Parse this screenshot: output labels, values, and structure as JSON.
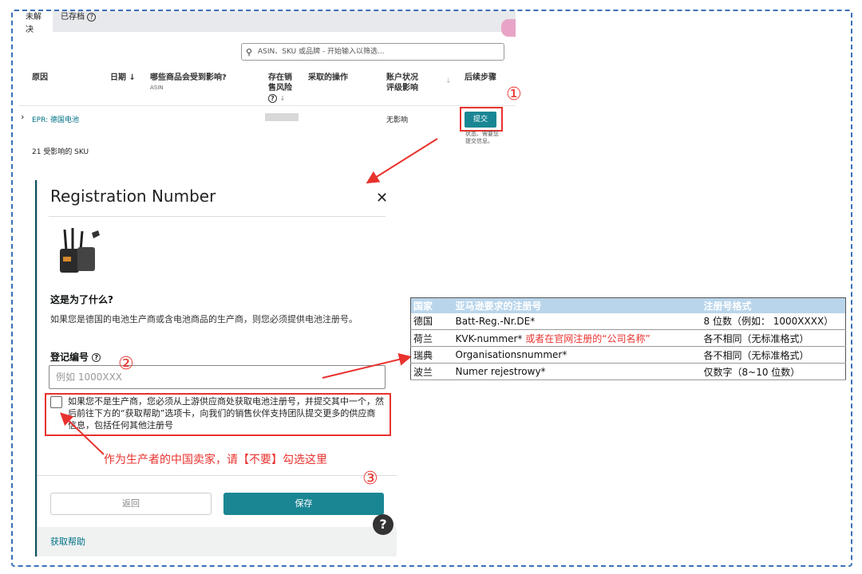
{
  "tabs": {
    "unresolved": "未解决",
    "archived": "已存档"
  },
  "search": {
    "placeholder": "ASIN、SKU 或品牌 - 开始输入以筛选..."
  },
  "columns": {
    "reason": "原因",
    "date": "日期 ↓",
    "affected": "哪些商品会受到影响?",
    "affected_sub": "ASIN",
    "risk_line1": "存在销",
    "risk_line2": "售风险",
    "action": "采取的操作",
    "health_line1": "账户状况",
    "health_line2": "评级影响",
    "next": "后续步骤"
  },
  "row": {
    "reason": "EPR: 德国电池",
    "health": "无影响",
    "submit": "提交",
    "status_note": "状态、需要您提交信息。",
    "sku_count": "21 受影响的 SKU"
  },
  "markers": {
    "one": "①",
    "two": "②",
    "three": "③"
  },
  "modal": {
    "title": "Registration Number",
    "why_heading": "这是为了什么?",
    "why_text": "如果您是德国的电池生产商或含电池商品的生产商，则您必须提供电池注册号。",
    "reg_label": "登记编号",
    "reg_placeholder": "例如 1000XXX",
    "checkbox_text": "如果您不是生产商，您必须从上游供应商处获取电池注册号，并提交其中一个，然后前往下方的“获取帮助”选项卡，向我们的销售伙伴支持团队提交更多的供应商信息，包括任何其他注册号",
    "back": "返回",
    "save": "保存",
    "help": "获取帮助"
  },
  "annotation": "作为生产者的中国卖家，请【不要】勾选这里",
  "reg_table": {
    "headers": [
      "国家",
      "亚马逊要求的注册号",
      "注册号格式"
    ],
    "rows": [
      {
        "country": "德国",
        "number": "Batt-Reg.-Nr.DE*",
        "note": "",
        "format": "8 位数（例如： 1000XXXX）"
      },
      {
        "country": "荷兰",
        "number": "KVK-nummer*",
        "note": "或者在官网注册的“公司名称”",
        "format": "各不相同（无标准格式）"
      },
      {
        "country": "瑞典",
        "number": "Organisationsnummer*",
        "note": "",
        "format": "各不相同（无标准格式）"
      },
      {
        "country": "波兰",
        "number": "Numer rejestrowy*",
        "note": "",
        "format": "仅数字（8~10 位数）"
      }
    ]
  },
  "colors": {
    "teal": "#1a8694",
    "red": "#e8322e",
    "frame": "#3b6fb6"
  }
}
